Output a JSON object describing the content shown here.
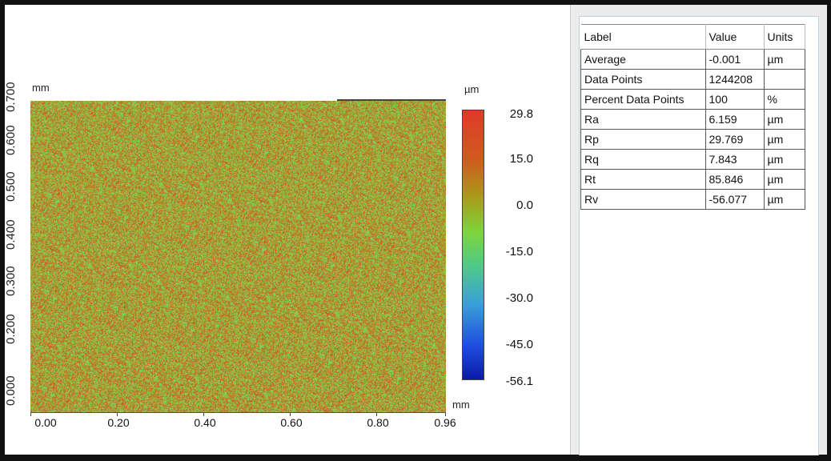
{
  "plot": {
    "x_unit": "mm",
    "y_unit": "mm",
    "z_unit": "µm",
    "x_ticks": [
      "0.00",
      "0.20",
      "0.40",
      "0.60",
      "0.80",
      "0.96"
    ],
    "y_ticks": [
      "0.000",
      "0.200",
      "0.300",
      "0.400",
      "0.500",
      "0.600",
      "0.700"
    ],
    "colorbar_labels": [
      "29.8",
      "15.0",
      "0.0",
      "-15.0",
      "-30.0",
      "-45.0",
      "-56.1"
    ]
  },
  "table": {
    "headers": [
      "Label",
      "Value",
      "Units"
    ],
    "rows": [
      [
        "Average",
        "-0.001",
        "µm"
      ],
      [
        "Data Points",
        "1244208",
        ""
      ],
      [
        "Percent Data Points",
        "100",
        "%"
      ],
      [
        "Ra",
        "6.159",
        "µm"
      ],
      [
        "Rp",
        "29.769",
        "µm"
      ],
      [
        "Rq",
        "7.843",
        "µm"
      ],
      [
        "Rt",
        "85.846",
        "µm"
      ],
      [
        "Rv",
        "-56.077",
        "µm"
      ]
    ]
  }
}
